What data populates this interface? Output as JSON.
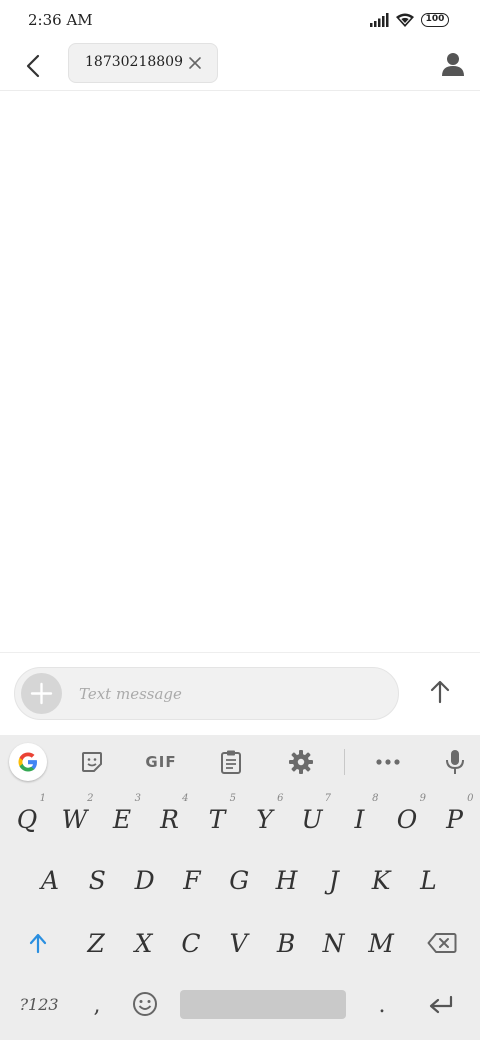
{
  "status_bar": {
    "time": "2:36 AM",
    "battery": "100"
  },
  "header": {
    "recipient": "18730218809"
  },
  "compose": {
    "placeholder": "Text message"
  },
  "keyboard": {
    "toolbar": {
      "gif_label": "GIF"
    },
    "row1": [
      {
        "label": "Q",
        "hint": "1"
      },
      {
        "label": "W",
        "hint": "2"
      },
      {
        "label": "E",
        "hint": "3"
      },
      {
        "label": "R",
        "hint": "4"
      },
      {
        "label": "T",
        "hint": "5"
      },
      {
        "label": "Y",
        "hint": "6"
      },
      {
        "label": "U",
        "hint": "7"
      },
      {
        "label": "I",
        "hint": "8"
      },
      {
        "label": "O",
        "hint": "9"
      },
      {
        "label": "P",
        "hint": "0"
      }
    ],
    "row2": [
      "A",
      "S",
      "D",
      "F",
      "G",
      "H",
      "J",
      "K",
      "L"
    ],
    "row3": [
      "Z",
      "X",
      "C",
      "V",
      "B",
      "N",
      "M"
    ],
    "bottom": {
      "symbols": "?123",
      "comma": ",",
      "period": "."
    }
  },
  "colors": {
    "shift_accent": "#2a8fe0"
  },
  "icons": [
    "back-arrow-icon",
    "close-icon",
    "person-icon",
    "plus-icon",
    "arrow-up-icon",
    "google-icon",
    "sticker-icon",
    "clipboard-icon",
    "gear-icon",
    "more-icon",
    "mic-icon",
    "shift-icon",
    "backspace-icon",
    "emoji-icon",
    "enter-icon",
    "signal-icon",
    "wifi-icon"
  ]
}
